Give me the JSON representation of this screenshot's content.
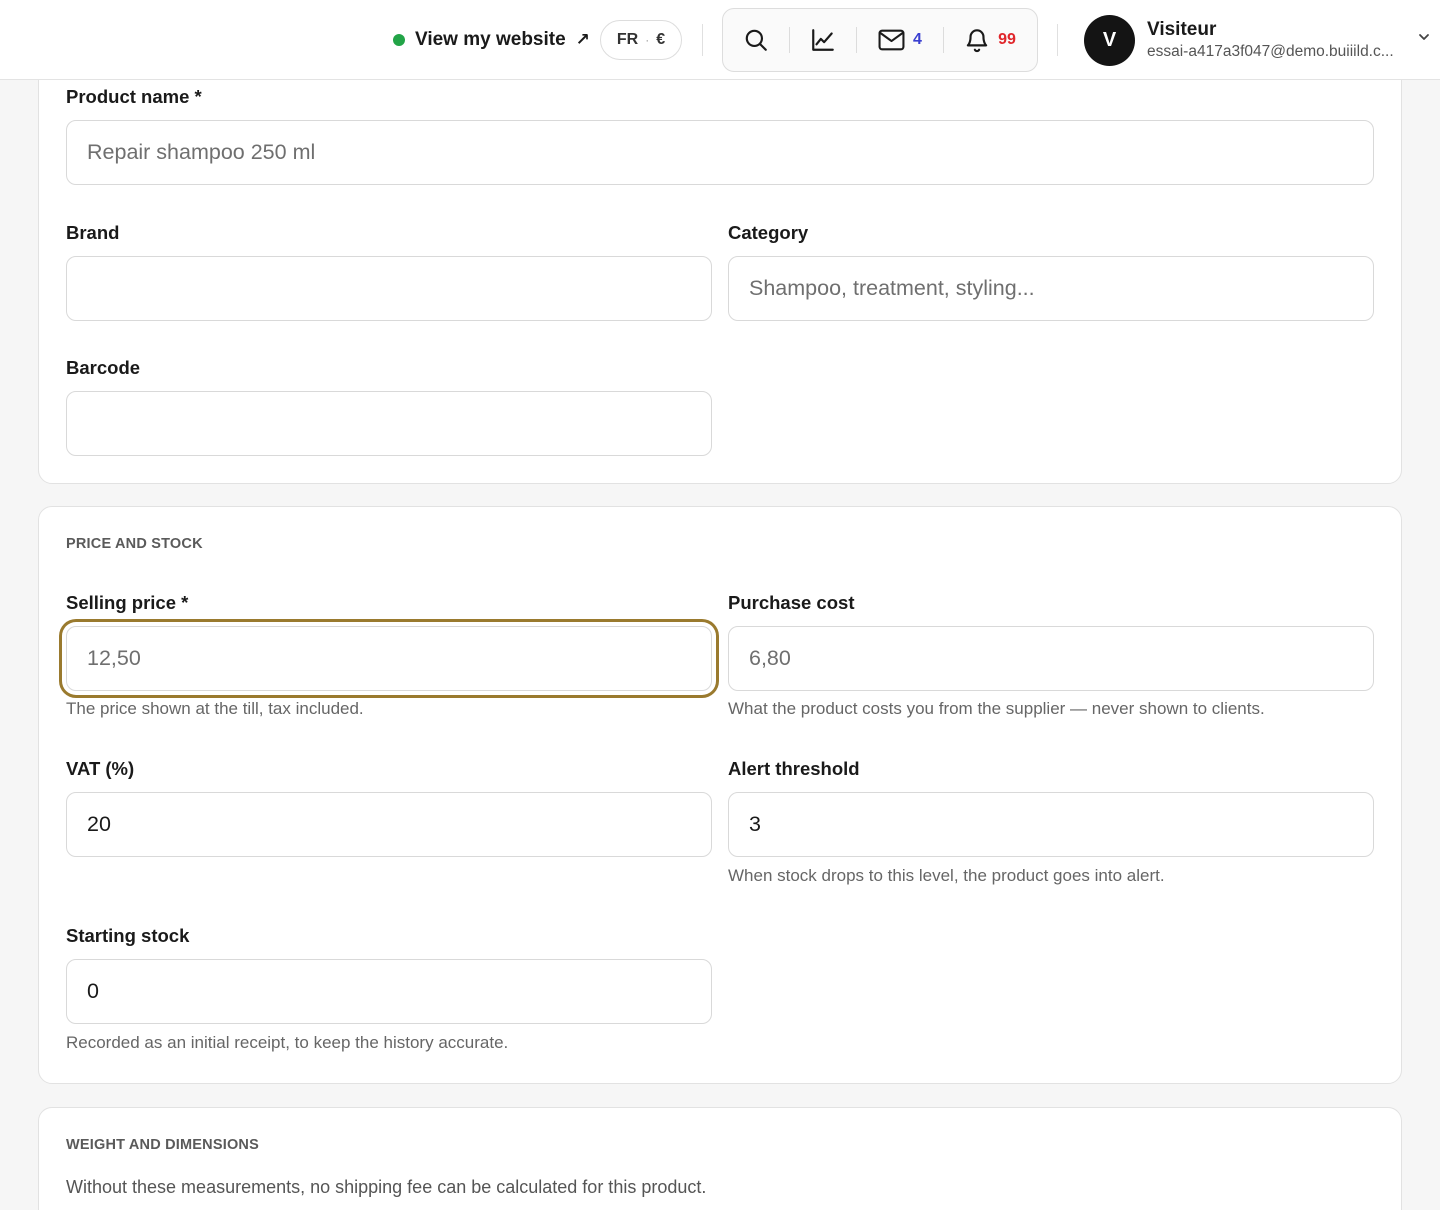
{
  "topbar": {
    "view_site_label": "View my website",
    "view_site_arrow": "↗",
    "locale_lang": "FR",
    "locale_sep": "·",
    "locale_currency": "€",
    "messages_count": "4",
    "notifications_count": "99",
    "user_initial": "V",
    "user_name": "Visiteur",
    "user_email": "essai-a417a3f047@demo.buiiild.c..."
  },
  "icons": {
    "status": "status-dot-icon",
    "search": "search-icon",
    "stats": "chart-line-icon",
    "messages": "mail-icon",
    "notifications": "bell-icon",
    "user_menu": "chevron-down-icon"
  },
  "colors": {
    "status_dot": "#22a447",
    "messages_badge": "#3a3fd0",
    "notifications_badge": "#e0262b",
    "focus_ring": "#9a7a2e",
    "avatar_bg": "#141414"
  },
  "product_info": {
    "product_name": {
      "label": "Product name *",
      "placeholder": "Repair shampoo 250 ml",
      "value": ""
    },
    "brand": {
      "label": "Brand",
      "placeholder": "",
      "value": ""
    },
    "category": {
      "label": "Category",
      "placeholder": "Shampoo, treatment, styling...",
      "value": ""
    },
    "barcode": {
      "label": "Barcode",
      "placeholder": "",
      "value": ""
    }
  },
  "price_stock": {
    "title": "PRICE AND STOCK",
    "selling_price": {
      "label": "Selling price *",
      "placeholder": "12,50",
      "value": "",
      "help": "The price shown at the till, tax included."
    },
    "purchase_cost": {
      "label": "Purchase cost",
      "placeholder": "6,80",
      "value": "",
      "help": "What the product costs you from the supplier — never shown to clients."
    },
    "vat": {
      "label": "VAT (%)",
      "value": "20"
    },
    "alert_threshold": {
      "label": "Alert threshold",
      "value": "3",
      "help": "When stock drops to this level, the product goes into alert."
    },
    "starting_stock": {
      "label": "Starting stock",
      "value": "0",
      "help": "Recorded as an initial receipt, to keep the history accurate."
    }
  },
  "weight_dimensions": {
    "title": "WEIGHT AND DIMENSIONS",
    "note": "Without these measurements, no shipping fee can be calculated for this product."
  }
}
